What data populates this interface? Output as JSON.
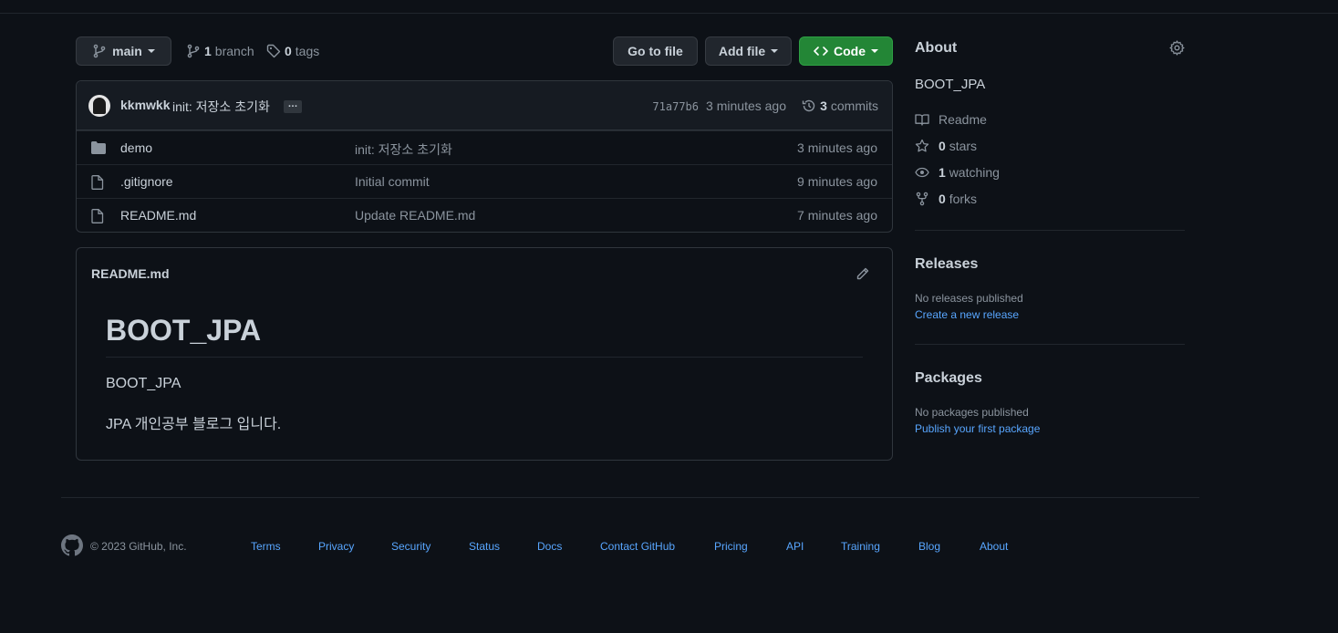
{
  "toolbar": {
    "branch_name": "main",
    "branch_count": "1",
    "branch_label": "branch",
    "tag_count": "0",
    "tag_label": "tags",
    "go_to_file": "Go to file",
    "add_file": "Add file",
    "code": "Code"
  },
  "commit": {
    "author": "kkmwkk",
    "message": "init: 저장소 초기화",
    "ellipsis": "…",
    "hash": "71a77b6",
    "time": "3 minutes ago",
    "count": "3",
    "count_label": "commits"
  },
  "files": [
    {
      "name": "demo",
      "type": "folder",
      "message": "init: 저장소 초기화",
      "time": "3 minutes ago"
    },
    {
      "name": ".gitignore",
      "type": "file",
      "message": "Initial commit",
      "time": "9 minutes ago"
    },
    {
      "name": "README.md",
      "type": "file",
      "message": "Update README.md",
      "time": "7 minutes ago"
    }
  ],
  "readme": {
    "filename": "README.md",
    "heading": "BOOT_JPA",
    "paragraph1": "BOOT_JPA",
    "paragraph2": "JPA 개인공부 블로그 입니다."
  },
  "about": {
    "title": "About",
    "description": "BOOT_JPA",
    "readme": "Readme",
    "stars_count": "0",
    "stars_label": "stars",
    "watching_count": "1",
    "watching_label": "watching",
    "forks_count": "0",
    "forks_label": "forks"
  },
  "releases": {
    "title": "Releases",
    "none": "No releases published",
    "link": "Create a new release"
  },
  "packages": {
    "title": "Packages",
    "none": "No packages published",
    "link": "Publish your first package"
  },
  "footer": {
    "copyright": "© 2023 GitHub, Inc.",
    "links": [
      "Terms",
      "Privacy",
      "Security",
      "Status",
      "Docs",
      "Contact GitHub",
      "Pricing",
      "API",
      "Training",
      "Blog",
      "About"
    ]
  },
  "colors": {
    "background": "#0d1117",
    "accent_green": "#238636",
    "link_blue": "#58a6ff",
    "muted": "#8b949e"
  }
}
